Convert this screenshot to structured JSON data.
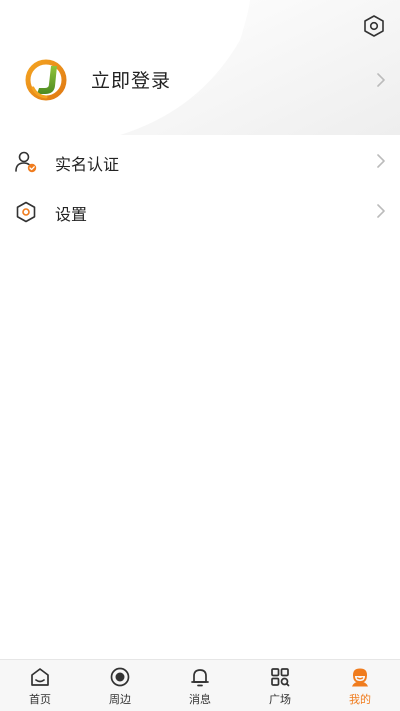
{
  "colors": {
    "accent": "#f07c1e",
    "text": "#222222",
    "chevron": "#bbbbbb",
    "tabbar_bg": "#f7f7f7"
  },
  "header": {
    "settings_icon": "hexagon-gear-icon"
  },
  "profile": {
    "login_label": "立即登录",
    "avatar_icon": "app-logo-j"
  },
  "menu": {
    "items": [
      {
        "label": "实名认证",
        "icon": "user-verified-icon"
      },
      {
        "label": "设置",
        "icon": "hexagon-settings-icon"
      }
    ]
  },
  "tabbar": {
    "active": "我的",
    "tabs": [
      {
        "label": "首页",
        "icon": "home-icon"
      },
      {
        "label": "周边",
        "icon": "nearby-icon"
      },
      {
        "label": "消息",
        "icon": "bell-icon"
      },
      {
        "label": "广场",
        "icon": "square-grid-icon"
      },
      {
        "label": "我的",
        "icon": "profile-icon"
      }
    ]
  }
}
